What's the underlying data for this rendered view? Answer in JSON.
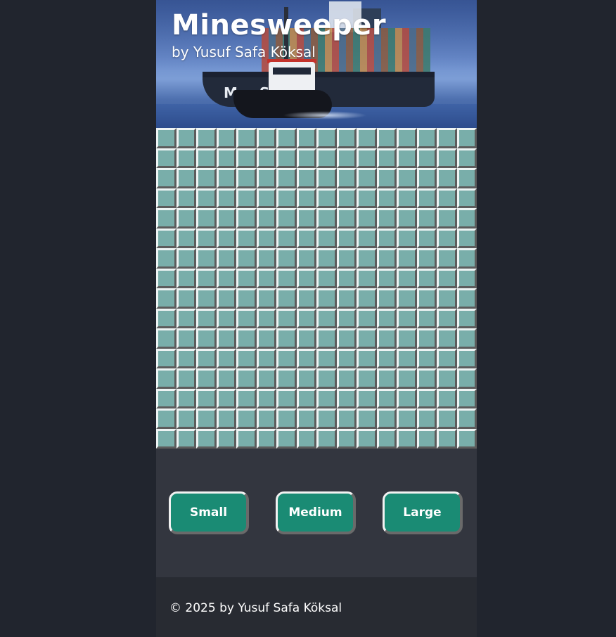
{
  "header": {
    "title": "Minesweeper",
    "subtitle": "by Yusuf Safa Köksal",
    "hull_lettering": "M S"
  },
  "board": {
    "rows": 16,
    "columns": 16,
    "state": "all-unrevealed",
    "cell_color": "#79aeaa"
  },
  "size_buttons": {
    "small": "Small",
    "medium": "Medium",
    "large": "Large",
    "button_color": "#1a8b74"
  },
  "footer": {
    "copyright": "© 2025 by Yusuf Safa Köksal"
  }
}
